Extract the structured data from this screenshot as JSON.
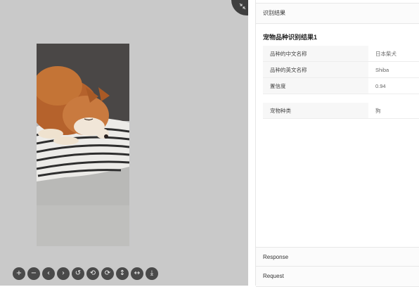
{
  "viewer": {
    "toolbar": [
      {
        "name": "zoom-in-icon",
        "glyph": "+"
      },
      {
        "name": "zoom-out-icon",
        "glyph": "−"
      },
      {
        "name": "previous-icon",
        "glyph": "‹"
      },
      {
        "name": "next-icon",
        "glyph": "›"
      },
      {
        "name": "reset-icon",
        "glyph": "↺"
      },
      {
        "name": "rotate-left-icon",
        "glyph": "⟲"
      },
      {
        "name": "rotate-right-icon",
        "glyph": "⟳"
      },
      {
        "name": "flip-vertical-icon",
        "glyph": "↕"
      },
      {
        "name": "flip-horizontal-icon",
        "glyph": "↔"
      },
      {
        "name": "download-icon",
        "glyph": "⤓"
      }
    ]
  },
  "panel": {
    "header": "识别结果",
    "result_title": "宠物品种识别结果1",
    "rows": [
      {
        "key": "品种的中文名称",
        "value": "日本柴犬"
      },
      {
        "key": "品种的英文名称",
        "value": "Shiba"
      },
      {
        "key": "置信度",
        "value": "0.94"
      }
    ],
    "extra_rows": [
      {
        "key": "宠物种类",
        "value": "狗"
      }
    ],
    "response_label": "Response",
    "request_label": "Request"
  }
}
